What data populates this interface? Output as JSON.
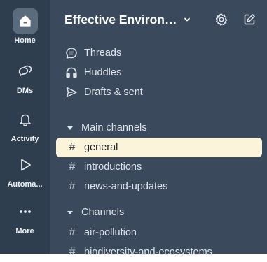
{
  "rail": {
    "items": [
      {
        "label": "Home",
        "icon": "home-icon",
        "active": true
      },
      {
        "label": "DMs",
        "icon": "dms-icon",
        "active": false
      },
      {
        "label": "Activity",
        "icon": "bell-icon",
        "active": false
      },
      {
        "label": "Automa...",
        "icon": "play-icon",
        "active": false
      },
      {
        "label": "More",
        "icon": "more-icon",
        "active": false
      }
    ]
  },
  "header": {
    "workspace_name": "Effective Environment Slack",
    "settings_icon": "gear-icon",
    "compose_icon": "compose-icon"
  },
  "nav": {
    "threads": "Threads",
    "huddles": "Huddles",
    "drafts": "Drafts & sent"
  },
  "sections": {
    "main_channels": {
      "title": "Main channels",
      "channels": [
        "general",
        "introductions",
        "news-and-updates"
      ]
    },
    "channels": {
      "title": "Channels",
      "channels": [
        "air-pollution",
        "biodiversity-and-ecosystems"
      ]
    }
  },
  "selected_channel": "general",
  "colors": {
    "rail_bg": "#2e3e4f",
    "sidebar_bg": "#3a4a5c",
    "selected_bg": "#fcf4da",
    "text": "#dfe4ea"
  }
}
